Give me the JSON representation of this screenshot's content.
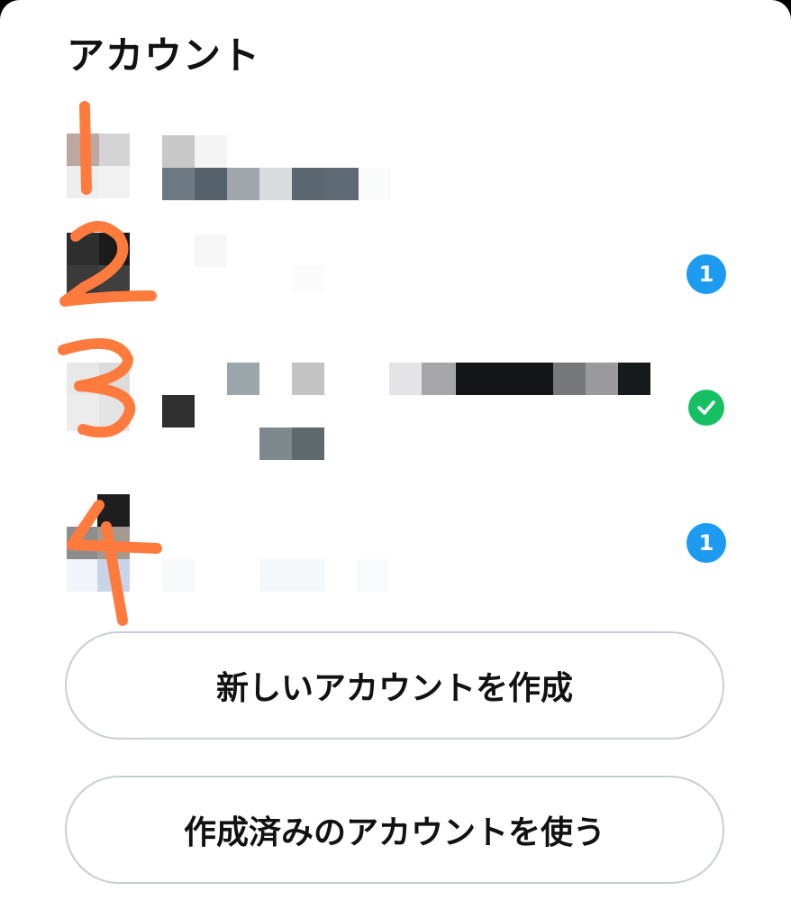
{
  "sheet": {
    "title": "アカウント"
  },
  "accounts": [
    {
      "badge": null
    },
    {
      "badge": "1"
    },
    {
      "badge": "check"
    },
    {
      "badge": "1"
    }
  ],
  "buttons": {
    "create_new": "新しいアカウントを作成",
    "use_existing": "作成済みのアカウントを使う"
  },
  "colors": {
    "badge_blue": "#1d9bf0",
    "badge_green": "#17bf63",
    "scribble": "#ff7a3d",
    "button_border": "#c5cfd6"
  }
}
